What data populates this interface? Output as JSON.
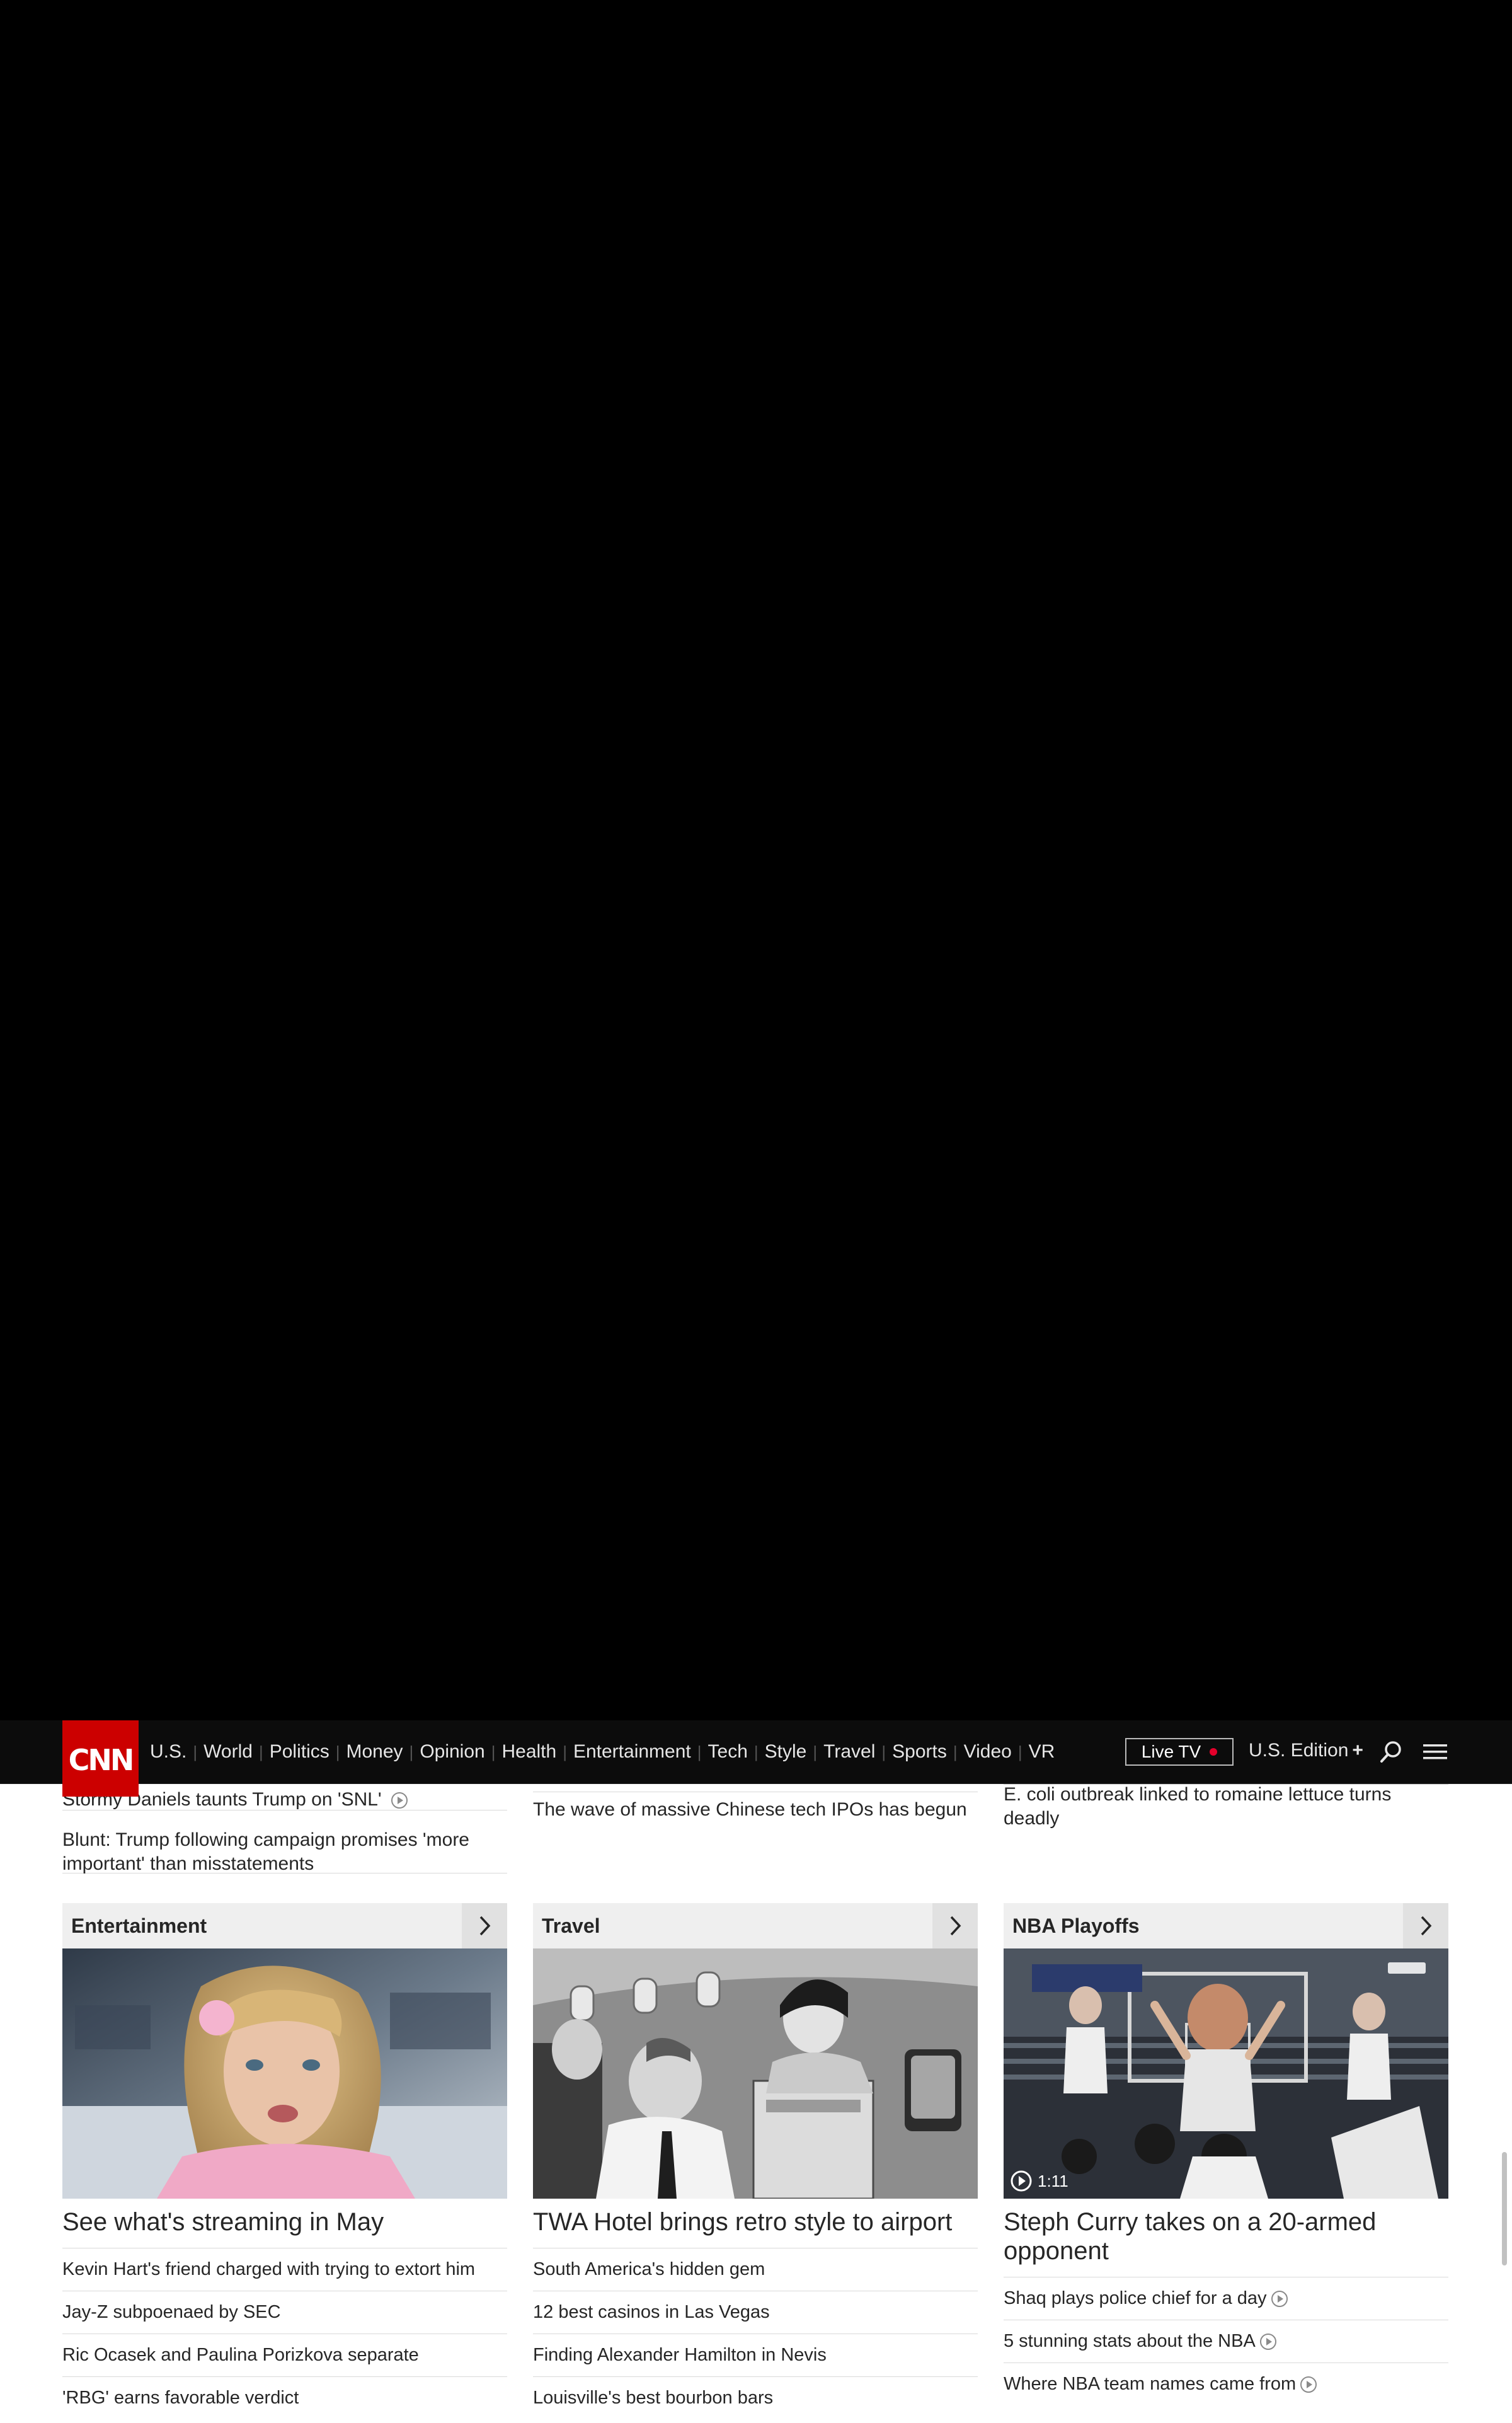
{
  "nav": {
    "logo": "CNN",
    "links": [
      "U.S.",
      "World",
      "Politics",
      "Money",
      "Opinion",
      "Health",
      "Entertainment",
      "Tech",
      "Style",
      "Travel",
      "Sports",
      "Video",
      "VR"
    ],
    "live_tv": "Live TV",
    "edition": "U.S. Edition",
    "edition_plus": "+"
  },
  "top_lists": {
    "col1": [
      "Stormy Daniels taunts Trump on 'SNL'",
      "Blunt: Trump following campaign promises 'more important' than misstatements"
    ],
    "col2": [
      "The wave of massive Chinese tech IPOs has begun"
    ],
    "col3": [
      "E. coli outbreak linked to romaine lettuce turns deadly"
    ]
  },
  "zones": [
    {
      "title": "Entertainment",
      "headline": "See what's streaming in May",
      "items": [
        "Kevin Hart's friend charged with trying to extort him",
        "Jay-Z subpoenaed by SEC",
        "Ric Ocasek and Paulina Porizkova separate",
        "'RBG' earns favorable verdict"
      ]
    },
    {
      "title": "Travel",
      "headline": "TWA Hotel brings retro style to airport",
      "items": [
        "South America's hidden gem",
        "12 best casinos in Las Vegas",
        "Finding Alexander Hamilton in Nevis",
        "Louisville's best bourbon bars"
      ]
    },
    {
      "title": "NBA Playoffs",
      "headline": "Steph Curry takes on a 20-armed opponent",
      "video_duration": "1:11",
      "items": [
        "Shaq plays police chief for a day",
        "5 stunning stats about the NBA",
        "Where NBA team names came from"
      ]
    }
  ],
  "colors": {
    "brand": "#cc0000",
    "live_dot": "#e4002b",
    "nav_bg": "#0c0c0c"
  }
}
